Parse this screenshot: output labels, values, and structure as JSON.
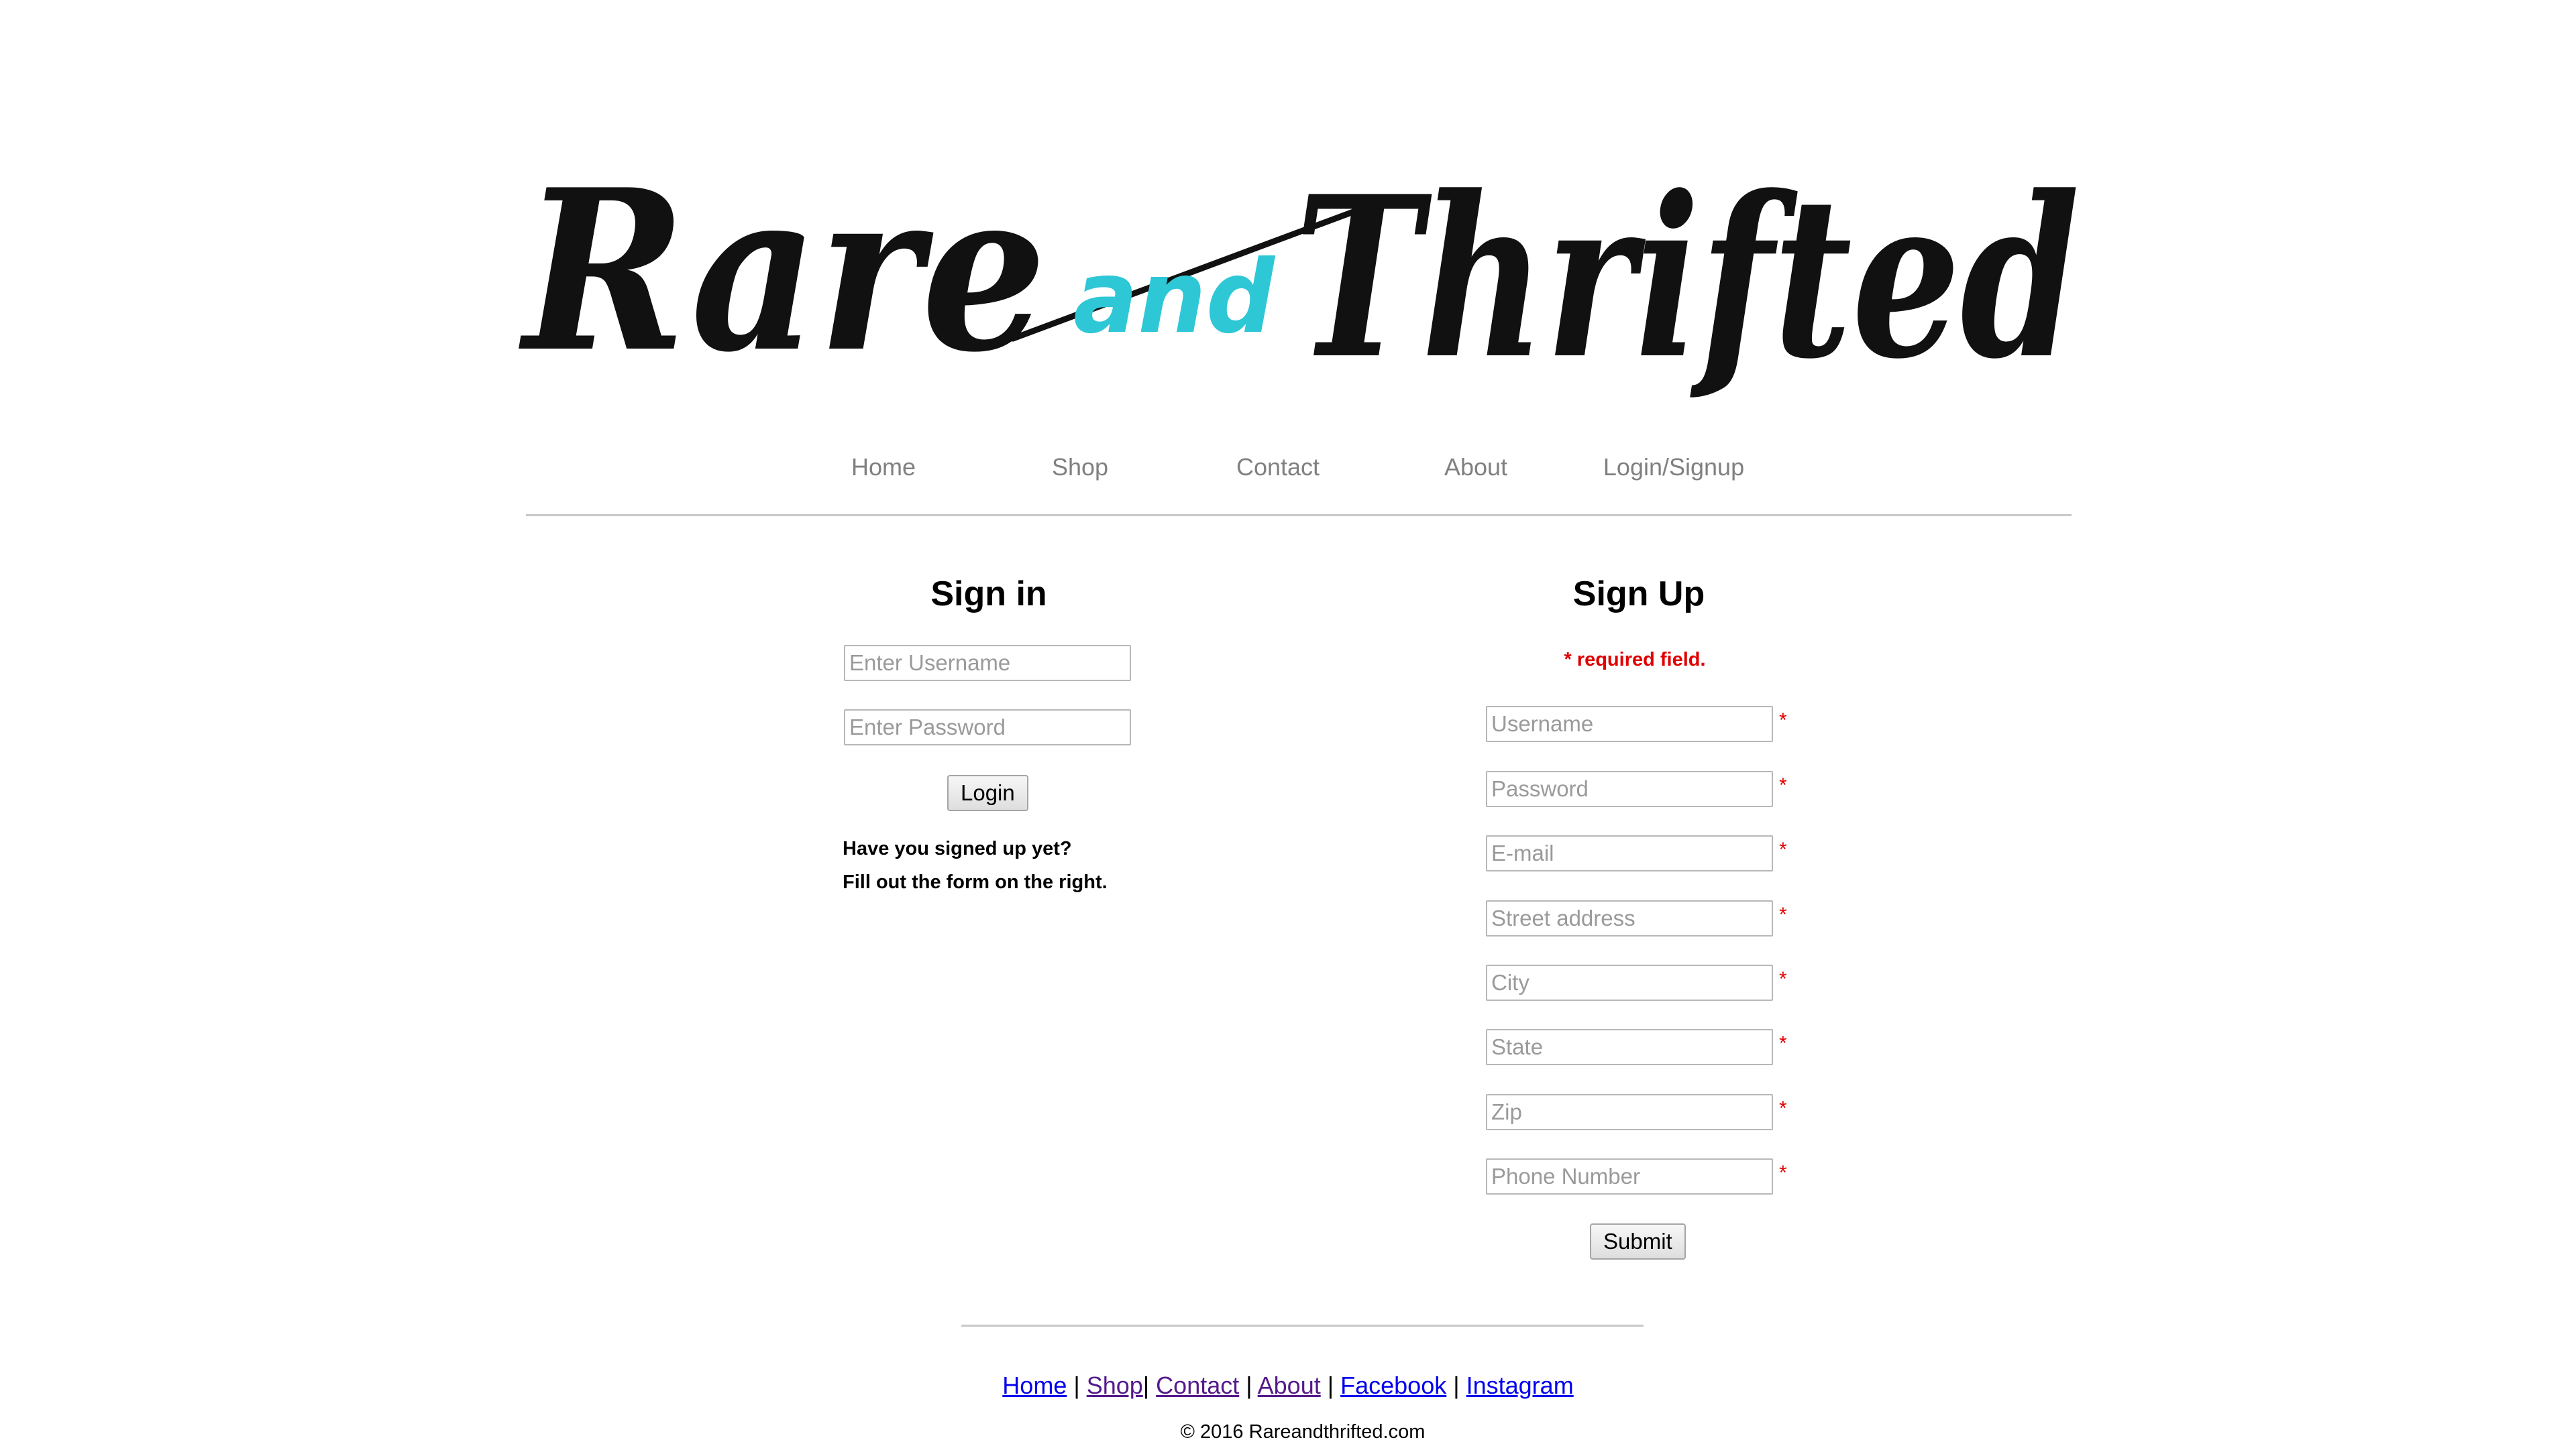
{
  "brand": {
    "logo_words": [
      "Rare",
      "and",
      "Thrifted"
    ],
    "logo_and_color": "#2ec7d6",
    "logo_word_color": "#111111"
  },
  "nav": {
    "items": [
      {
        "label": "Home"
      },
      {
        "label": "Shop"
      },
      {
        "label": "Contact"
      },
      {
        "label": "About"
      },
      {
        "label": "Login/Signup"
      }
    ]
  },
  "signin": {
    "title": "Sign in",
    "username_placeholder": "Enter Username",
    "password_placeholder": "Enter Password",
    "login_label": "Login",
    "note_line1": "Have you signed up yet?",
    "note_line2": "Fill out the form on the right."
  },
  "signup": {
    "title": "Sign Up",
    "required_note": "* required field.",
    "required_marker": "*",
    "fields": [
      {
        "placeholder": "Username"
      },
      {
        "placeholder": "Password"
      },
      {
        "placeholder": "E-mail"
      },
      {
        "placeholder": "Street address"
      },
      {
        "placeholder": "City"
      },
      {
        "placeholder": "State"
      },
      {
        "placeholder": "Zip"
      },
      {
        "placeholder": "Phone Number"
      }
    ],
    "submit_label": "Submit"
  },
  "footer": {
    "links": [
      {
        "label": "Home",
        "visited": false
      },
      {
        "label": "Shop",
        "visited": true
      },
      {
        "label": "Contact",
        "visited": true
      },
      {
        "label": "About",
        "visited": true
      },
      {
        "label": "Facebook",
        "visited": false
      },
      {
        "label": "Instagram",
        "visited": false
      }
    ],
    "separator": "|",
    "copyright": "© 2016 Rareandthrifted.com"
  },
  "colors": {
    "nav_text": "#808080",
    "required": "#e00000",
    "link": "#0000ee",
    "link_visited": "#551a8b",
    "rule": "#c8c8c8"
  }
}
